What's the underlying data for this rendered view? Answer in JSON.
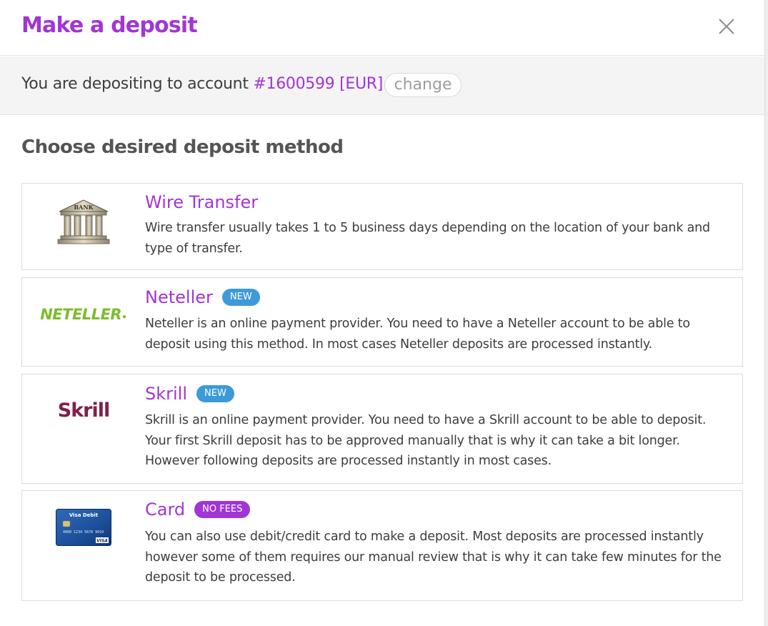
{
  "header": {
    "title": "Make a deposit",
    "close_icon": "close-icon"
  },
  "account_bar": {
    "prefix": "You are depositing to account",
    "account": "#1600599 [EUR]",
    "change_label": "change"
  },
  "section_title": "Choose desired deposit method",
  "methods": [
    {
      "title": "Wire Transfer",
      "badge": "",
      "description": "Wire transfer usually takes 1 to 5 business days depending on the location of your bank and type of transfer.",
      "logo": "bank-icon",
      "logo_text": "BANK"
    },
    {
      "title": "Neteller",
      "badge": "NEW",
      "description": "Neteller is an online payment provider. You need to have a Neteller account to be able to deposit using this method. In most cases Neteller deposits are processed instantly.",
      "logo": "neteller-logo",
      "logo_text": "NETELLER"
    },
    {
      "title": "Skrill",
      "badge": "NEW",
      "description": "Skrill is an online payment provider. You need to have a Skrill account to be able to deposit. Your first Skrill deposit has to be approved manually that is why it can take a bit longer. However following deposits are processed instantly in most cases.",
      "logo": "skrill-logo",
      "logo_text": "Skrill"
    },
    {
      "title": "Card",
      "badge": "NO FEES",
      "description": "You can also use debit/credit card to make a deposit. Most deposits are processed instantly however some of them requires our manual review that is why it can take few minutes for the deposit to be processed.",
      "logo": "visa-debit-card-icon",
      "logo_text": "Visa Debit",
      "logo_brand": "VISA",
      "logo_number": "4000 1234 5678 9010"
    }
  ],
  "colors": {
    "accent": "#a235d6",
    "badge_new": "#3d9ad9",
    "badge_nofees": "#a235d6",
    "neteller_green": "#7cbd2e",
    "skrill_maroon": "#811f4b"
  }
}
